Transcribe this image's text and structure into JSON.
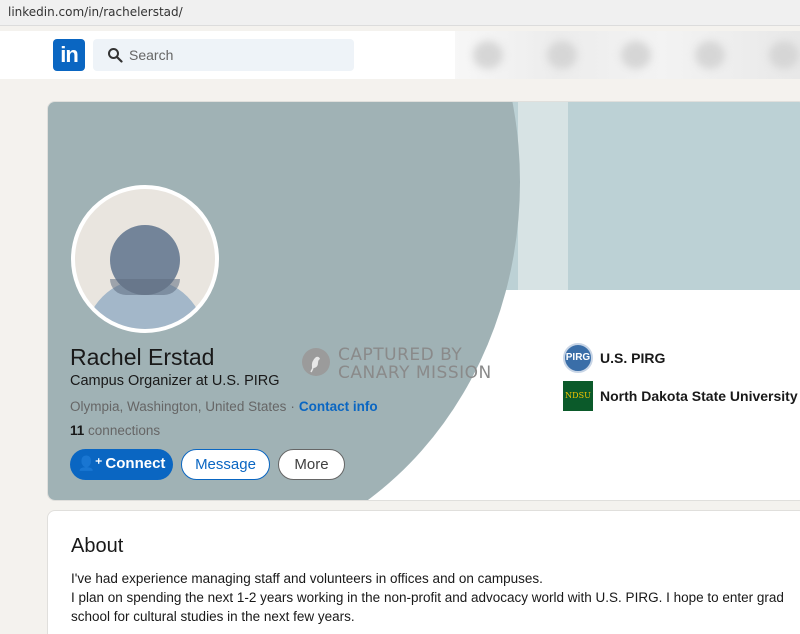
{
  "browser": {
    "url": "linkedin.com/in/rachelerstad/"
  },
  "nav": {
    "logo_text": "in",
    "search_placeholder": "Search"
  },
  "profile": {
    "name": "Rachel Erstad",
    "headline": "Campus Organizer at U.S. PIRG",
    "location": "Olympia, Washington, United States",
    "separator": "·",
    "contact_label": "Contact info",
    "connections_count": "11",
    "connections_label": "connections"
  },
  "stamp": {
    "line1": "CAPTURED BY",
    "line2": "CANARY MISSION"
  },
  "organizations": [
    {
      "name": "U.S. PIRG",
      "logo_text": "PIRG"
    },
    {
      "name": "North Dakota State University",
      "logo_text": "NDSU"
    }
  ],
  "actions": {
    "connect": "Connect",
    "message": "Message",
    "more": "More"
  },
  "about": {
    "title": "About",
    "line1": "I've had experience managing staff and volunteers in offices and on campuses.",
    "line2": "I plan on spending the next 1-2 years working in the non-profit and advocacy world with U.S. PIRG. I hope to enter grad school for cultural studies in the next few years."
  },
  "colors": {
    "brand": "#0a66c2",
    "banner": "#bcd1d5"
  }
}
